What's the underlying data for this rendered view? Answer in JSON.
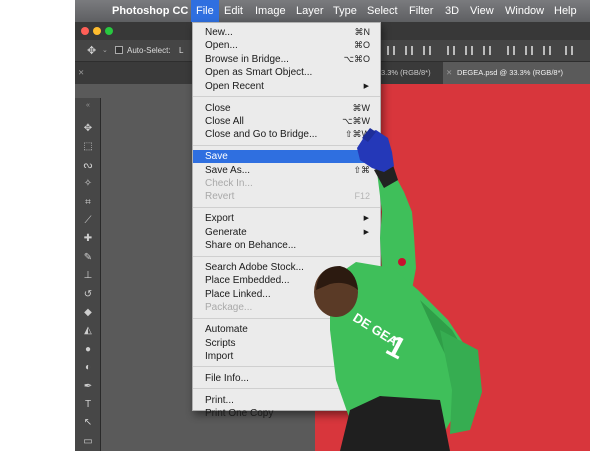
{
  "menubar": {
    "apple_glyph": "",
    "app_name": "Photoshop CC",
    "items": [
      "File",
      "Edit",
      "Image",
      "Layer",
      "Type",
      "Select",
      "Filter",
      "3D",
      "View",
      "Window",
      "Help"
    ]
  },
  "options_bar": {
    "auto_select_label": "Auto-Select:",
    "auto_select_value": "L"
  },
  "tabs": [
    {
      "label": "3.3% (RGB/8*)"
    },
    {
      "label": "DEGEA.psd @ 33.3% (RGB/8*)"
    }
  ],
  "file_menu": {
    "items": [
      {
        "label": "New...",
        "shortcut": "⌘N"
      },
      {
        "label": "Open...",
        "shortcut": "⌘O"
      },
      {
        "label": "Browse in Bridge...",
        "shortcut": "⌥⌘O"
      },
      {
        "label": "Open as Smart Object...",
        "shortcut": ""
      },
      {
        "label": "Open Recent",
        "shortcut": "",
        "submenu": true
      },
      {
        "label": "Close",
        "shortcut": "⌘W"
      },
      {
        "label": "Close All",
        "shortcut": "⌥⌘W"
      },
      {
        "label": "Close and Go to Bridge...",
        "shortcut": "⇧⌘W"
      },
      {
        "label": "Save",
        "shortcut": "⌘",
        "highlighted": true
      },
      {
        "label": "Save As...",
        "shortcut": "⇧⌘"
      },
      {
        "label": "Check In...",
        "shortcut": "",
        "disabled": true
      },
      {
        "label": "Revert",
        "shortcut": "F12",
        "disabled": true
      },
      {
        "label": "Export",
        "shortcut": "",
        "submenu": true
      },
      {
        "label": "Generate",
        "shortcut": "",
        "submenu": true
      },
      {
        "label": "Share on Behance...",
        "shortcut": ""
      },
      {
        "label": "Search Adobe Stock...",
        "shortcut": ""
      },
      {
        "label": "Place Embedded...",
        "shortcut": ""
      },
      {
        "label": "Place Linked...",
        "shortcut": ""
      },
      {
        "label": "Package...",
        "shortcut": "",
        "disabled": true
      },
      {
        "label": "Automate",
        "shortcut": "",
        "submenu": true
      },
      {
        "label": "Scripts",
        "shortcut": "",
        "submenu": true
      },
      {
        "label": "Import",
        "shortcut": "",
        "submenu": true
      },
      {
        "label": "File Info...",
        "shortcut": ""
      },
      {
        "label": "Print...",
        "shortcut": ""
      },
      {
        "label": "Print One Copy",
        "shortcut": "⌥⌘"
      }
    ]
  },
  "canvas": {
    "jersey_name": "DE GEA",
    "jersey_number": "1"
  },
  "colors": {
    "highlight": "#2f6fe0",
    "canvas_bg": "#d8363c",
    "jersey": "#3fbf5a"
  },
  "tool_icons": [
    "move-icon",
    "marquee-icon",
    "lasso-icon",
    "magic-wand-icon",
    "crop-icon",
    "eyedropper-icon",
    "healing-icon",
    "brush-icon",
    "stamp-icon",
    "history-brush-icon",
    "eraser-icon",
    "paint-bucket-icon",
    "blur-icon",
    "dodge-icon",
    "pen-icon",
    "type-icon",
    "path-select-icon",
    "shape-icon"
  ]
}
